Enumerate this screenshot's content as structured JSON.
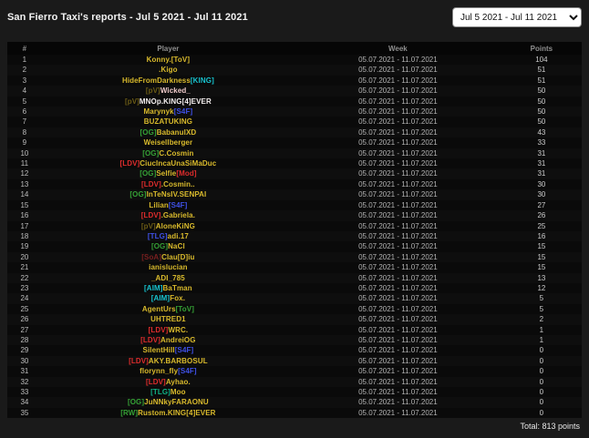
{
  "page": {
    "title": "San Fierro Taxi's reports - Jul 5 2021 - Jul 11 2021",
    "background": "#1a1a1a"
  },
  "filter": {
    "selected_range": "Jul 5 2021 - Jul 11 2021"
  },
  "colors": {
    "name_yellow": "#d9ba2c",
    "name_white": "#f5f0f0",
    "name_pink_white": "#efcaca",
    "tag_green": "#35a135",
    "tag_red": "#dd2c2c",
    "tag_dark_red": "#7a1f1f",
    "tag_blue": "#3f51e8",
    "tag_cyan": "#17c3cf",
    "tag_teal": "#10b487",
    "tag_dark_olive": "#6b5b15"
  },
  "table": {
    "headers": [
      "#",
      "Player",
      "Week",
      "Points"
    ],
    "week": "05.07.2021 - 11.07.2021",
    "rows": [
      {
        "rank": 1,
        "name": [
          {
            "t": "Konny.[ToV]",
            "c": "#d9ba2c"
          }
        ],
        "points": 104
      },
      {
        "rank": 2,
        "name": [
          {
            "t": ".Kigo",
            "c": "#d9ba2c"
          }
        ],
        "points": 51
      },
      {
        "rank": 3,
        "name": [
          {
            "t": "HideFromDarkness",
            "c": "#d9ba2c"
          },
          {
            "t": "[KING]",
            "c": "#17c3cf"
          }
        ],
        "points": 51
      },
      {
        "rank": 4,
        "name": [
          {
            "t": "[pV]",
            "c": "#6b5b15"
          },
          {
            "t": "Wicked_",
            "c": "#efcaca"
          }
        ],
        "points": 50
      },
      {
        "rank": 5,
        "name": [
          {
            "t": "[pV]",
            "c": "#6b5b15"
          },
          {
            "t": "MNOp.KING[4]EVER",
            "c": "#f5f0f0"
          }
        ],
        "points": 50
      },
      {
        "rank": 6,
        "name": [
          {
            "t": "Marynyk",
            "c": "#d9ba2c"
          },
          {
            "t": "[S4F]",
            "c": "#3f51e8"
          }
        ],
        "points": 50
      },
      {
        "rank": 7,
        "name": [
          {
            "t": "BUZATUKING",
            "c": "#d9ba2c"
          }
        ],
        "points": 50
      },
      {
        "rank": 8,
        "name": [
          {
            "t": "[OG]",
            "c": "#35a135"
          },
          {
            "t": "BabanuIXD",
            "c": "#d9ba2c"
          }
        ],
        "points": 43
      },
      {
        "rank": 9,
        "name": [
          {
            "t": "Weisellberger",
            "c": "#d9ba2c"
          }
        ],
        "points": 33
      },
      {
        "rank": 10,
        "name": [
          {
            "t": "[OG]",
            "c": "#35a135"
          },
          {
            "t": "C.Cosmin",
            "c": "#d9ba2c"
          }
        ],
        "points": 31
      },
      {
        "rank": 11,
        "name": [
          {
            "t": "[LDV]",
            "c": "#dd2c2c"
          },
          {
            "t": "CiucIncaUnaSiMaDuc",
            "c": "#d9ba2c"
          }
        ],
        "points": 31
      },
      {
        "rank": 12,
        "name": [
          {
            "t": "[OG]",
            "c": "#35a135"
          },
          {
            "t": "Selfie",
            "c": "#d9ba2c"
          },
          {
            "t": "[Mod]",
            "c": "#dd2c2c"
          }
        ],
        "points": 31
      },
      {
        "rank": 13,
        "name": [
          {
            "t": "[LDV]",
            "c": "#dd2c2c"
          },
          {
            "t": ".Cosmin..",
            "c": "#d9ba2c"
          }
        ],
        "points": 30
      },
      {
        "rank": 14,
        "name": [
          {
            "t": "[OG]",
            "c": "#35a135"
          },
          {
            "t": "InTeNsIV.SENPAI",
            "c": "#d9ba2c"
          }
        ],
        "points": 30
      },
      {
        "rank": 15,
        "name": [
          {
            "t": "Lilian",
            "c": "#d9ba2c"
          },
          {
            "t": "[S4F]",
            "c": "#3f51e8"
          }
        ],
        "points": 27
      },
      {
        "rank": 16,
        "name": [
          {
            "t": "[LDV]",
            "c": "#dd2c2c"
          },
          {
            "t": ".Gabriela.",
            "c": "#d9ba2c"
          }
        ],
        "points": 26
      },
      {
        "rank": 17,
        "name": [
          {
            "t": "[pV]",
            "c": "#6b5b15"
          },
          {
            "t": "AloneKiNG",
            "c": "#d9ba2c"
          }
        ],
        "points": 25
      },
      {
        "rank": 18,
        "name": [
          {
            "t": "[TLG]",
            "c": "#3f51e8"
          },
          {
            "t": "adi.17",
            "c": "#d9ba2c"
          }
        ],
        "points": 16
      },
      {
        "rank": 19,
        "name": [
          {
            "t": "[OG]",
            "c": "#35a135"
          },
          {
            "t": "NaCl",
            "c": "#d9ba2c"
          }
        ],
        "points": 15
      },
      {
        "rank": 20,
        "name": [
          {
            "t": "[SoA]",
            "c": "#7a1f1f"
          },
          {
            "t": "Clau[D]iu",
            "c": "#d9ba2c"
          }
        ],
        "points": 15
      },
      {
        "rank": 21,
        "name": [
          {
            "t": "ianislucian",
            "c": "#d9ba2c"
          }
        ],
        "points": 15
      },
      {
        "rank": 22,
        "name": [
          {
            "t": "_ADI_785",
            "c": "#d9ba2c"
          }
        ],
        "points": 13
      },
      {
        "rank": 23,
        "name": [
          {
            "t": "[AIM]",
            "c": "#17c3cf"
          },
          {
            "t": "BaTman",
            "c": "#d9ba2c"
          }
        ],
        "points": 12
      },
      {
        "rank": 24,
        "name": [
          {
            "t": "[AIM]",
            "c": "#17c3cf"
          },
          {
            "t": "Fox.",
            "c": "#d9ba2c"
          }
        ],
        "points": 5
      },
      {
        "rank": 25,
        "name": [
          {
            "t": "AgentUrs",
            "c": "#d9ba2c"
          },
          {
            "t": "[ToV]",
            "c": "#35a135"
          }
        ],
        "points": 5
      },
      {
        "rank": 26,
        "name": [
          {
            "t": "UHTRED1",
            "c": "#d9ba2c"
          }
        ],
        "points": 2
      },
      {
        "rank": 27,
        "name": [
          {
            "t": "[LDV]",
            "c": "#dd2c2c"
          },
          {
            "t": "WRC.",
            "c": "#d9ba2c"
          }
        ],
        "points": 1
      },
      {
        "rank": 28,
        "name": [
          {
            "t": "[LDV]",
            "c": "#dd2c2c"
          },
          {
            "t": "AndreiOG",
            "c": "#d9ba2c"
          }
        ],
        "points": 1
      },
      {
        "rank": 29,
        "name": [
          {
            "t": "SilentHill",
            "c": "#d9ba2c"
          },
          {
            "t": "[S4F]",
            "c": "#3f51e8"
          }
        ],
        "points": 0
      },
      {
        "rank": 30,
        "name": [
          {
            "t": "[LDV]",
            "c": "#dd2c2c"
          },
          {
            "t": "AKY.BARBOSUL",
            "c": "#d9ba2c"
          }
        ],
        "points": 0
      },
      {
        "rank": 31,
        "name": [
          {
            "t": "florynn_fly",
            "c": "#d9ba2c"
          },
          {
            "t": "[S4F]",
            "c": "#3f51e8"
          }
        ],
        "points": 0
      },
      {
        "rank": 32,
        "name": [
          {
            "t": "[LDV]",
            "c": "#dd2c2c"
          },
          {
            "t": "Ayhao.",
            "c": "#d9ba2c"
          }
        ],
        "points": 0
      },
      {
        "rank": 33,
        "name": [
          {
            "t": "[TLG]",
            "c": "#10b487"
          },
          {
            "t": "Moo",
            "c": "#d9ba2c"
          }
        ],
        "points": 0
      },
      {
        "rank": 34,
        "name": [
          {
            "t": "[OG]",
            "c": "#35a135"
          },
          {
            "t": "JuNNkyFARAONU",
            "c": "#d9ba2c"
          }
        ],
        "points": 0
      },
      {
        "rank": 35,
        "name": [
          {
            "t": "[RW]",
            "c": "#35a135"
          },
          {
            "t": "Rustom.KING[4]EVER",
            "c": "#d9ba2c"
          }
        ],
        "points": 0
      }
    ]
  },
  "footer": {
    "total": "Total: 813 points"
  }
}
